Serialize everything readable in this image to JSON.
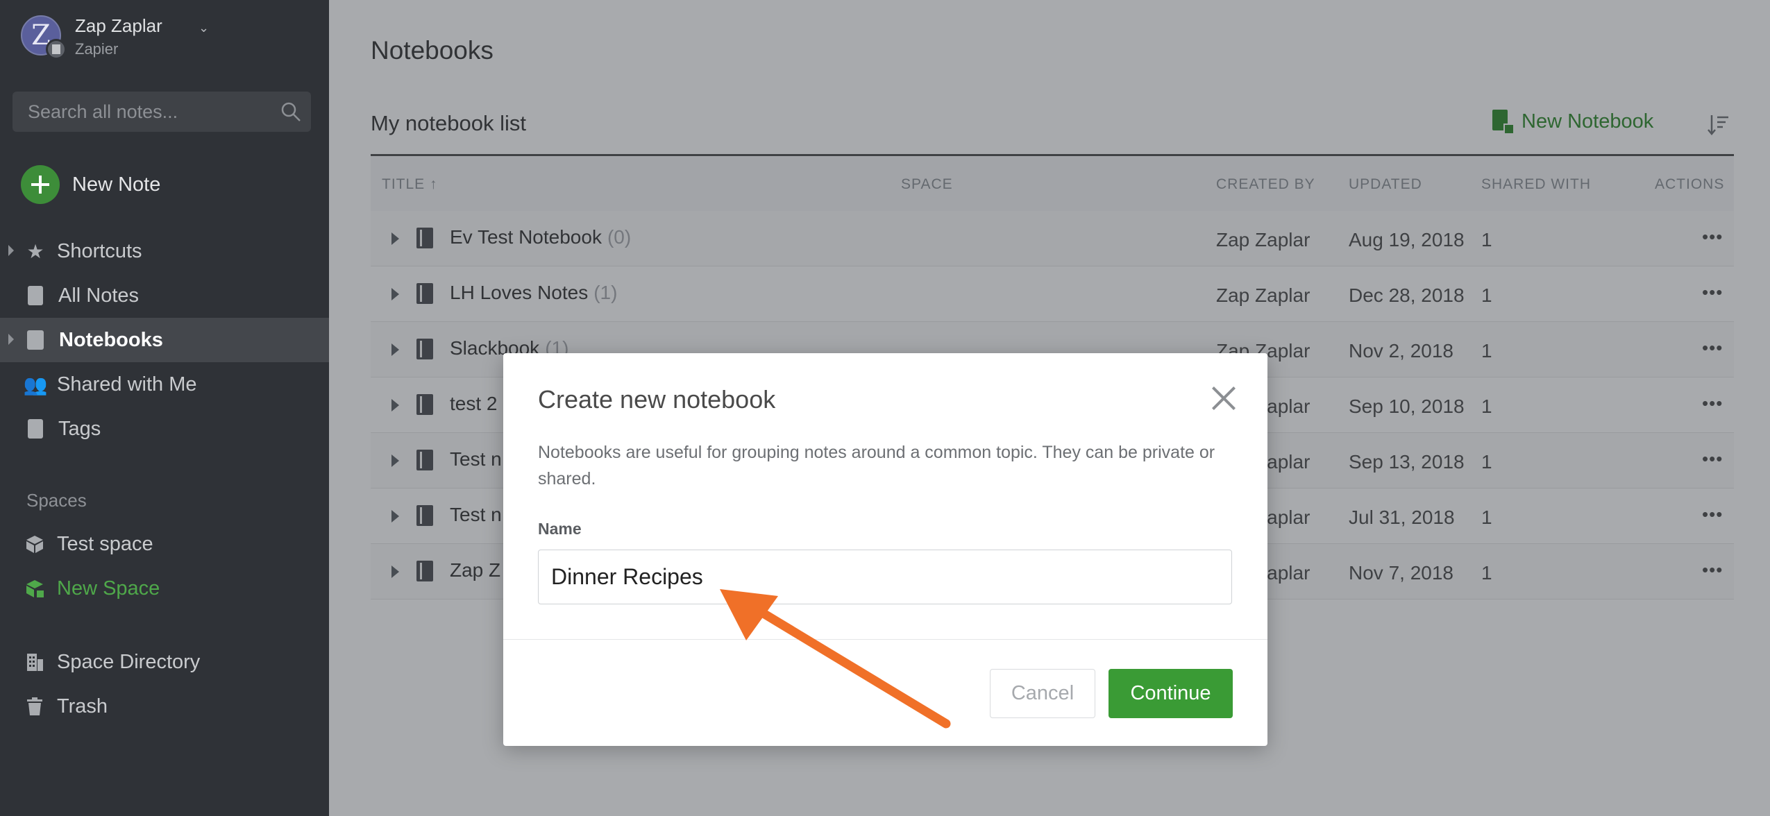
{
  "account": {
    "name": "Zap Zaplar",
    "org": "Zapier",
    "avatar_letter": "Z"
  },
  "search": {
    "placeholder": "Search all notes..."
  },
  "new_note": {
    "label": "New Note"
  },
  "nav": {
    "shortcuts": "Shortcuts",
    "all_notes": "All Notes",
    "notebooks": "Notebooks",
    "shared": "Shared with Me",
    "tags": "Tags"
  },
  "spaces": {
    "heading": "Spaces",
    "test_space": "Test space",
    "new_space": "New Space",
    "directory": "Space Directory",
    "trash": "Trash"
  },
  "main": {
    "title": "Notebooks",
    "list_title": "My notebook list",
    "new_notebook": "New Notebook",
    "columns": [
      "TITLE ↑",
      "SPACE",
      "CREATED BY",
      "UPDATED",
      "SHARED WITH",
      "ACTIONS"
    ]
  },
  "rows": [
    {
      "title": "Ev Test Notebook",
      "count": "(0)",
      "created_by": "Zap Zaplar",
      "updated": "Aug 19, 2018",
      "shared": "1"
    },
    {
      "title": "LH Loves Notes",
      "count": "(1)",
      "created_by": "Zap Zaplar",
      "updated": "Dec 28, 2018",
      "shared": "1"
    },
    {
      "title": "Slackbook",
      "count": "(1)",
      "created_by": "Zap Zaplar",
      "updated": "Nov 2, 2018",
      "shared": "1"
    },
    {
      "title": "test 2",
      "count": "",
      "created_by": "Zap Zaplar",
      "updated": "Sep 10, 2018",
      "shared": "1"
    },
    {
      "title": "Test n",
      "count": "",
      "created_by": "Zap Zaplar",
      "updated": "Sep 13, 2018",
      "shared": "1"
    },
    {
      "title": "Test n",
      "count": "",
      "created_by": "Zap Zaplar",
      "updated": "Jul 31, 2018",
      "shared": "1"
    },
    {
      "title": "Zap Z",
      "count": "",
      "created_by": "Zap Zaplar",
      "updated": "Nov 7, 2018",
      "shared": "1"
    }
  ],
  "more_glyph": "•••",
  "modal": {
    "title": "Create new notebook",
    "description": "Notebooks are useful for grouping notes around a common topic. They can be private or shared.",
    "name_label": "Name",
    "name_value": "Dinner Recipes",
    "cancel": "Cancel",
    "continue": "Continue"
  },
  "colors": {
    "sidebar_bg": "#2f3237",
    "accent_green": "#3a9b35",
    "annotation_arrow": "#f07028"
  }
}
